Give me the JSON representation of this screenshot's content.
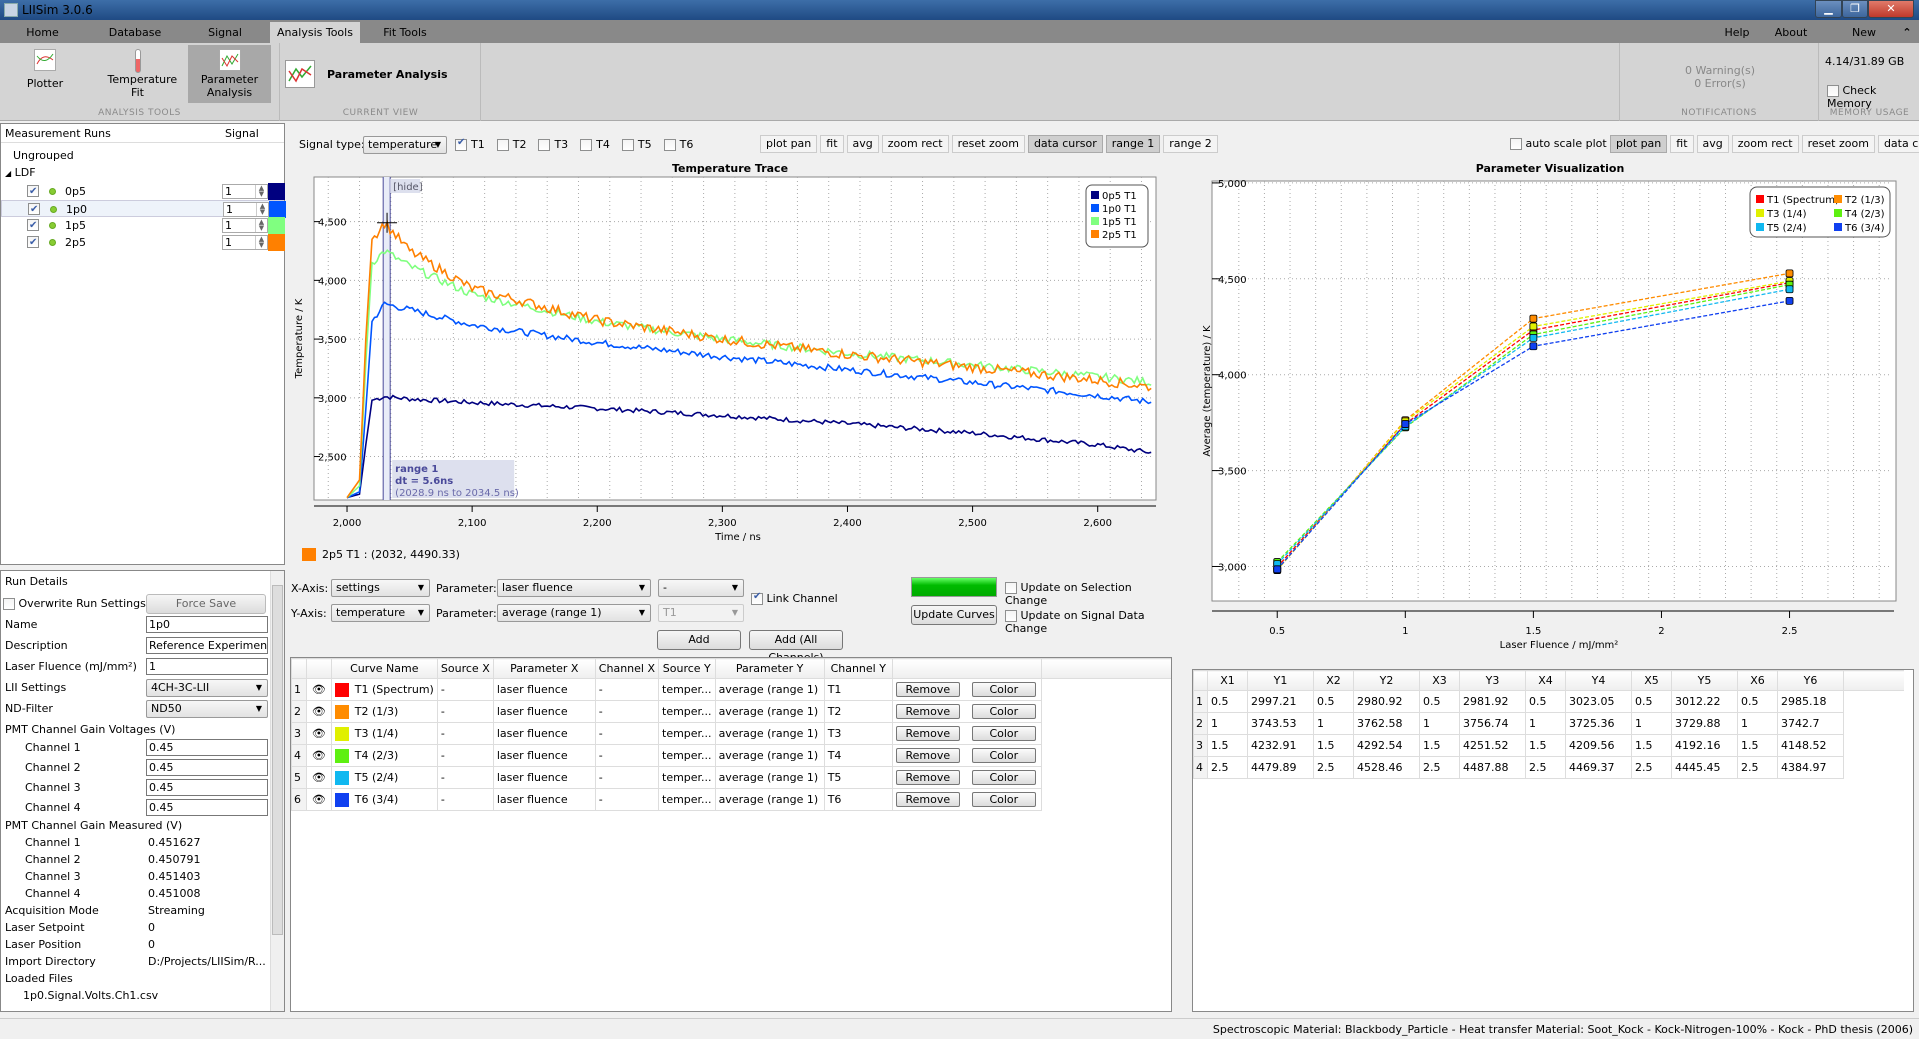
{
  "window": {
    "title": "LIISim 3.0.6"
  },
  "menu": {
    "tabs": [
      "Home",
      "Database",
      "Signal Processing",
      "Analysis Tools",
      "Fit Tools"
    ],
    "active_tab": "Analysis Tools",
    "right_links": [
      "Help",
      "About LIISim",
      "New Window"
    ]
  },
  "ribbon": {
    "analysis_tools": {
      "label": "ANALYSIS TOOLS",
      "buttons": [
        {
          "label": "Plotter",
          "icon": "plotter-icon"
        },
        {
          "label": "Temperature Fit",
          "icon": "thermometer-icon"
        },
        {
          "label": "Parameter Analysis",
          "icon": "parameter-analysis-icon"
        }
      ]
    },
    "current_view": {
      "label": "CURRENT VIEW",
      "title": "Parameter Analysis"
    },
    "notifications": {
      "label": "NOTIFICATIONS",
      "warnings": "0 Warning(s)",
      "errors": "0 Error(s)"
    },
    "memory": {
      "label": "MEMORY USAGE",
      "usage": "4.14/31.89 GB",
      "check_label": "Check Memory",
      "checked": false
    }
  },
  "runs": {
    "header": {
      "name": "Measurement Runs",
      "signal": "Signal"
    },
    "groups": [
      {
        "name": "Ungrouped",
        "items": []
      },
      {
        "name": "LDF",
        "items": [
          {
            "name": "0p5",
            "checked": true,
            "signal": "1",
            "color": "#000080"
          },
          {
            "name": "1p0",
            "checked": true,
            "signal": "1",
            "color": "#0055ff",
            "selected": true
          },
          {
            "name": "1p5",
            "checked": true,
            "signal": "1",
            "color": "#80ff80"
          },
          {
            "name": "2p5",
            "checked": true,
            "signal": "1",
            "color": "#ff8000"
          }
        ]
      }
    ]
  },
  "run_details": {
    "title": "Run Details",
    "overwrite_label": "Overwrite Run Settings",
    "force_save": "Force Save",
    "fields": [
      {
        "label": "Name",
        "value": "1p0",
        "type": "input"
      },
      {
        "label": "Description",
        "value": "Reference Experiment",
        "type": "input"
      },
      {
        "label": "Laser Fluence (mJ/mm²)",
        "value": "1",
        "type": "input"
      },
      {
        "label": "LII Settings",
        "value": "4CH-3C-LII",
        "type": "combo"
      },
      {
        "label": "ND-Filter",
        "value": "ND50",
        "type": "combo"
      }
    ],
    "gain_voltages_label": "PMT Channel Gain Voltages (V)",
    "gain_voltages": [
      {
        "label": "Channel 1",
        "value": "0.45"
      },
      {
        "label": "Channel 2",
        "value": "0.45"
      },
      {
        "label": "Channel 3",
        "value": "0.45"
      },
      {
        "label": "Channel 4",
        "value": "0.45"
      }
    ],
    "gain_measured_label": "PMT Channel Gain Measured (V)",
    "gain_measured": [
      {
        "label": "Channel 1",
        "value": "0.451627"
      },
      {
        "label": "Channel 2",
        "value": "0.450791"
      },
      {
        "label": "Channel 3",
        "value": "0.451403"
      },
      {
        "label": "Channel 4",
        "value": "0.451008"
      }
    ],
    "info": [
      {
        "label": "Acquisition Mode",
        "value": "Streaming"
      },
      {
        "label": "Laser Setpoint",
        "value": "0"
      },
      {
        "label": "Laser Position",
        "value": "0"
      },
      {
        "label": "Import Directory",
        "value": "D:/Projects/LIISim/R..."
      }
    ],
    "loaded_files_label": "Loaded Files",
    "loaded_files": [
      "1p0.Signal.Volts.Ch1.csv"
    ]
  },
  "signal_toolbar": {
    "signal_type_label": "Signal type:",
    "signal_type": "temperature",
    "channels": [
      {
        "label": "T1",
        "checked": true
      },
      {
        "label": "T2",
        "checked": false
      },
      {
        "label": "T3",
        "checked": false
      },
      {
        "label": "T4",
        "checked": false
      },
      {
        "label": "T5",
        "checked": false
      },
      {
        "label": "T6",
        "checked": false
      }
    ],
    "tools": [
      {
        "label": "plot pan",
        "active": false
      },
      {
        "label": "fit",
        "active": false
      },
      {
        "label": "avg",
        "active": false
      },
      {
        "label": "zoom rect",
        "active": false
      },
      {
        "label": "reset zoom",
        "active": false
      },
      {
        "label": "data cursor",
        "active": true
      },
      {
        "label": "range 1",
        "active": true
      },
      {
        "label": "range 2",
        "active": false
      }
    ]
  },
  "trace_plot": {
    "hide_label": "[hide]",
    "range_label": "range 1",
    "range_dt": "dt = 5.6ns",
    "range_span": "(2028.9 ns to 2034.5 ns)",
    "cursor_readout": "2p5 T1 : (2032, 4490.33)",
    "cursor_color": "#ff8000"
  },
  "axis_controls": {
    "x_axis_label": "X-Axis:",
    "x_axis": "settings",
    "x_param_label": "Parameter:",
    "x_param": "laser fluence",
    "x_channel": "-",
    "y_axis_label": "Y-Axis:",
    "y_axis": "temperature",
    "y_param_label": "Parameter:",
    "y_param": "average (range 1)",
    "y_channel": "T1",
    "link_channel": "Link Channel",
    "link_checked": true,
    "add": "Add",
    "add_all": "Add (All Channels)",
    "update_curves": "Update Curves",
    "update_on_selection": "Update on Selection Change",
    "update_on_signal": "Update on Signal Data Change",
    "progress": 1.0
  },
  "curve_table": {
    "headers": [
      "",
      "",
      "Curve Name",
      "Source X",
      "Parameter X",
      "Channel X",
      "Source Y",
      "Parameter Y",
      "Channel Y",
      ""
    ],
    "remove_label": "Remove",
    "color_label": "Color",
    "rows": [
      {
        "n": "1",
        "name": "T1 (Spectrum)",
        "color": "#ff0000",
        "src_x": "-",
        "param_x": "laser fluence",
        "ch_x": "-",
        "src_y": "temper...",
        "param_y": "average (range 1)",
        "ch_y": "T1"
      },
      {
        "n": "2",
        "name": "T2 (1/3)",
        "color": "#ff8c00",
        "src_x": "-",
        "param_x": "laser fluence",
        "ch_x": "-",
        "src_y": "temper...",
        "param_y": "average (range 1)",
        "ch_y": "T2"
      },
      {
        "n": "3",
        "name": "T3 (1/4)",
        "color": "#e0f000",
        "src_x": "-",
        "param_x": "laser fluence",
        "ch_x": "-",
        "src_y": "temper...",
        "param_y": "average (range 1)",
        "ch_y": "T3"
      },
      {
        "n": "4",
        "name": "T4 (2/3)",
        "color": "#5ef010",
        "src_x": "-",
        "param_x": "laser fluence",
        "ch_x": "-",
        "src_y": "temper...",
        "param_y": "average (range 1)",
        "ch_y": "T4"
      },
      {
        "n": "5",
        "name": "T5 (2/4)",
        "color": "#10b8f0",
        "src_x": "-",
        "param_x": "laser fluence",
        "ch_x": "-",
        "src_y": "temper...",
        "param_y": "average (range 1)",
        "ch_y": "T5"
      },
      {
        "n": "6",
        "name": "T6 (3/4)",
        "color": "#1040f0",
        "src_x": "-",
        "param_x": "laser fluence",
        "ch_x": "-",
        "src_y": "temper...",
        "param_y": "average (range 1)",
        "ch_y": "T6"
      }
    ]
  },
  "param_toolbar": {
    "auto_scale_label": "auto scale plot",
    "auto_scale": false,
    "tools": [
      {
        "label": "plot pan",
        "active": true
      },
      {
        "label": "fit",
        "active": false
      },
      {
        "label": "avg",
        "active": false
      },
      {
        "label": "zoom rect",
        "active": false
      },
      {
        "label": "reset zoom",
        "active": false
      },
      {
        "label": "data cursor",
        "active": false
      }
    ]
  },
  "data_table": {
    "headers": [
      "",
      "X1",
      "Y1",
      "X2",
      "Y2",
      "X3",
      "Y3",
      "X4",
      "Y4",
      "X5",
      "Y5",
      "X6",
      "Y6"
    ],
    "rows": [
      [
        "1",
        "0.5",
        "2997.21",
        "0.5",
        "2980.92",
        "0.5",
        "2981.92",
        "0.5",
        "3023.05",
        "0.5",
        "3012.22",
        "0.5",
        "2985.18"
      ],
      [
        "2",
        "1",
        "3743.53",
        "1",
        "3762.58",
        "1",
        "3756.74",
        "1",
        "3725.36",
        "1",
        "3729.88",
        "1",
        "3742.7"
      ],
      [
        "3",
        "1.5",
        "4232.91",
        "1.5",
        "4292.54",
        "1.5",
        "4251.52",
        "1.5",
        "4209.56",
        "1.5",
        "4192.16",
        "1.5",
        "4148.52"
      ],
      [
        "4",
        "2.5",
        "4479.89",
        "2.5",
        "4528.46",
        "2.5",
        "4487.88",
        "2.5",
        "4469.37",
        "2.5",
        "4445.45",
        "2.5",
        "4384.97"
      ]
    ]
  },
  "status": {
    "text": "Spectroscopic Material: Blackbody_Particle - Heat transfer Material: Soot_Kock - Kock-Nitrogen-100% - Kock - PhD thesis (2006)"
  },
  "chart_data": [
    {
      "type": "line",
      "title": "Temperature Trace",
      "xlabel": "Time / ns",
      "ylabel": "Temperature / K",
      "xlim": [
        1980,
        2645
      ],
      "ylim": [
        2130,
        4880
      ],
      "xticks": [
        2000,
        2100,
        2200,
        2300,
        2400,
        2500,
        2600
      ],
      "xtick_labels": [
        "2,000",
        "2,100",
        "2,200",
        "2,300",
        "2,400",
        "2,500",
        "2,600"
      ],
      "yticks": [
        2500,
        3000,
        3500,
        4000,
        4500
      ],
      "ytick_labels": [
        "2,500",
        "3,000",
        "3,500",
        "4,000",
        "4,500"
      ],
      "grid": true,
      "legend_position": "top-right",
      "range_ns": [
        2028.9,
        2034.5
      ],
      "cursor": {
        "x": 2032,
        "y": 4490.33
      },
      "series": [
        {
          "name": "0p5 T1",
          "color": "#000080",
          "x": [
            2000,
            2010,
            2015,
            2020,
            2030,
            2050,
            2100,
            2200,
            2300,
            2400,
            2500,
            2600,
            2645
          ],
          "y": [
            2150,
            2180,
            2600,
            2980,
            3010,
            2990,
            2960,
            2910,
            2850,
            2780,
            2700,
            2600,
            2530
          ]
        },
        {
          "name": "1p0 T1",
          "color": "#0055ff",
          "x": [
            2000,
            2010,
            2015,
            2020,
            2030,
            2050,
            2100,
            2200,
            2300,
            2400,
            2500,
            2600,
            2645
          ],
          "y": [
            2150,
            2200,
            2900,
            3650,
            3800,
            3750,
            3620,
            3470,
            3350,
            3240,
            3130,
            3020,
            2960
          ]
        },
        {
          "name": "1p5 T1",
          "color": "#80ff80",
          "x": [
            2000,
            2010,
            2015,
            2020,
            2030,
            2050,
            2100,
            2200,
            2300,
            2400,
            2500,
            2600,
            2645
          ],
          "y": [
            2150,
            2250,
            3300,
            4150,
            4250,
            4120,
            3880,
            3650,
            3500,
            3380,
            3280,
            3180,
            3130
          ]
        },
        {
          "name": "2p5 T1",
          "color": "#ff8000",
          "x": [
            2000,
            2010,
            2015,
            2020,
            2030,
            2050,
            2100,
            2200,
            2300,
            2400,
            2500,
            2600,
            2645
          ],
          "y": [
            2150,
            2300,
            3500,
            4350,
            4490,
            4250,
            3930,
            3660,
            3500,
            3370,
            3260,
            3150,
            3090
          ]
        }
      ]
    },
    {
      "type": "line",
      "title": "Parameter Visualization",
      "xlabel": "Laser Fluence / mJ/mm²",
      "ylabel": "Average (temperature) / K",
      "xlim": [
        0.3,
        2.9
      ],
      "ylim": [
        2820,
        5010
      ],
      "xticks": [
        0.5,
        1,
        1.5,
        2,
        2.5
      ],
      "xtick_labels": [
        "0.5",
        "1",
        "1.5",
        "2",
        "2.5"
      ],
      "yticks": [
        3000,
        3500,
        4000,
        4500,
        5000
      ],
      "ytick_labels": [
        "3,000",
        "3,500",
        "4,000",
        "4,500",
        "5,000"
      ],
      "grid": true,
      "legend_position": "top-right",
      "x": [
        0.5,
        1,
        1.5,
        2.5
      ],
      "series": [
        {
          "name": "T1 (Spectrum)",
          "color": "#ff0000",
          "values": [
            2997.21,
            3743.53,
            4232.91,
            4479.89
          ]
        },
        {
          "name": "T2 (1/3)",
          "color": "#ff8c00",
          "values": [
            2980.92,
            3762.58,
            4292.54,
            4528.46
          ]
        },
        {
          "name": "T3 (1/4)",
          "color": "#e0f000",
          "values": [
            2981.92,
            3756.74,
            4251.52,
            4487.88
          ]
        },
        {
          "name": "T4 (2/3)",
          "color": "#5ef010",
          "values": [
            3023.05,
            3725.36,
            4209.56,
            4469.37
          ]
        },
        {
          "name": "T5 (2/4)",
          "color": "#10b8f0",
          "values": [
            3012.22,
            3729.88,
            4192.16,
            4445.45
          ]
        },
        {
          "name": "T6 (3/4)",
          "color": "#1040f0",
          "values": [
            2985.18,
            3742.7,
            4148.52,
            4384.97
          ]
        }
      ]
    }
  ]
}
